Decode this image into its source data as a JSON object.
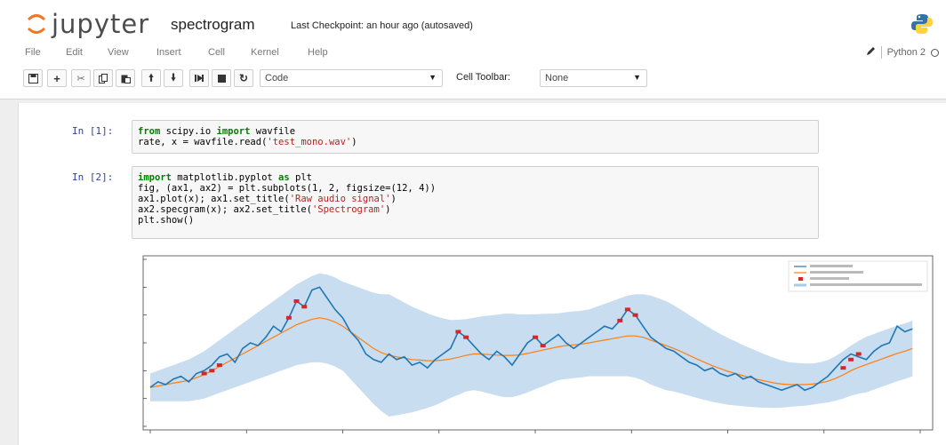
{
  "header": {
    "brand": "jupyter",
    "notebook_name": "spectrogram",
    "checkpoint": "Last Checkpoint: an hour ago (autosaved)"
  },
  "menu": {
    "items": [
      "File",
      "Edit",
      "View",
      "Insert",
      "Cell",
      "Kernel",
      "Help"
    ],
    "kernel_name": "Python 2"
  },
  "toolbar": {
    "cell_type": "Code",
    "cell_toolbar_label": "Cell Toolbar:",
    "cell_toolbar_value": "None",
    "icons": [
      "save-icon",
      "plus-icon",
      "scissors-icon",
      "copy-icon",
      "paste-icon",
      "arrow-up-icon",
      "arrow-down-icon",
      "skip-to-end-icon",
      "stop-icon",
      "restart-icon"
    ]
  },
  "cells": [
    {
      "prompt": "In [1]:",
      "lines": [
        "from scipy.io import wavfile",
        "rate, x = wavfile.read('test_mono.wav')"
      ]
    },
    {
      "prompt": "In [2]:",
      "lines": [
        "import matplotlib.pyplot as plt",
        "fig, (ax1, ax2) = plt.subplots(1, 2, figsize=(12, 4))",
        "ax1.plot(x); ax1.set_title('Raw audio signal')",
        "ax2.specgram(x); ax2.set_title('Spectrogram')",
        "plt.show()"
      ]
    }
  ],
  "colors": {
    "prompt": "#303f9f",
    "keyword": "#008000",
    "string": "#ba2121",
    "series_actual": "#1f77b4",
    "series_average": "#ff7f0e",
    "band": "#aacbe6",
    "anomaly": "#d62728"
  },
  "chart_data": {
    "type": "line",
    "xlim": [
      0,
      100
    ],
    "ylim": [
      0,
      6
    ],
    "legend_position": "top-right",
    "series": [
      {
        "values": [
          1.4,
          1.6,
          1.5,
          1.7,
          1.8,
          1.6,
          1.9,
          2.0,
          2.2,
          2.5,
          2.6,
          2.3,
          2.8,
          3.0,
          2.9,
          3.2,
          3.6,
          3.4,
          3.9,
          4.5,
          4.3,
          4.9,
          5.0,
          4.6,
          4.2,
          3.9,
          3.4,
          3.1,
          2.6,
          2.4,
          2.3,
          2.6,
          2.4,
          2.5,
          2.2,
          2.3,
          2.1,
          2.4,
          2.6,
          2.8,
          3.4,
          3.2,
          2.9,
          2.6,
          2.4,
          2.7,
          2.5,
          2.2,
          2.6,
          3.0,
          3.2,
          2.9,
          3.1,
          3.3,
          3.0,
          2.8,
          3.0,
          3.2,
          3.4,
          3.6,
          3.5,
          3.8,
          4.2,
          4.0,
          3.6,
          3.2,
          3.0,
          2.8,
          2.7,
          2.5,
          2.3,
          2.2,
          2.0,
          2.1,
          1.9,
          1.8,
          1.9,
          1.7,
          1.8,
          1.6,
          1.5,
          1.4,
          1.3,
          1.4,
          1.5,
          1.3,
          1.4,
          1.6,
          1.8,
          2.1,
          2.4,
          2.6,
          2.5,
          2.4,
          2.7,
          2.9,
          3.0,
          3.6,
          3.4,
          3.5
        ]
      },
      {
        "values": [
          1.4,
          1.45,
          1.5,
          1.55,
          1.6,
          1.65,
          1.75,
          1.85,
          2.0,
          2.15,
          2.3,
          2.45,
          2.6,
          2.75,
          2.9,
          3.05,
          3.2,
          3.35,
          3.5,
          3.65,
          3.75,
          3.85,
          3.9,
          3.85,
          3.75,
          3.6,
          3.4,
          3.2,
          3.0,
          2.8,
          2.65,
          2.55,
          2.5,
          2.45,
          2.4,
          2.38,
          2.36,
          2.36,
          2.38,
          2.42,
          2.48,
          2.55,
          2.6,
          2.6,
          2.58,
          2.56,
          2.55,
          2.55,
          2.57,
          2.62,
          2.68,
          2.74,
          2.8,
          2.86,
          2.9,
          2.93,
          2.96,
          3.0,
          3.05,
          3.1,
          3.15,
          3.2,
          3.25,
          3.25,
          3.2,
          3.1,
          3.0,
          2.9,
          2.8,
          2.68,
          2.55,
          2.42,
          2.3,
          2.18,
          2.08,
          1.98,
          1.9,
          1.82,
          1.75,
          1.68,
          1.62,
          1.56,
          1.52,
          1.5,
          1.5,
          1.5,
          1.52,
          1.56,
          1.62,
          1.72,
          1.85,
          2.0,
          2.12,
          2.22,
          2.32,
          2.42,
          2.52,
          2.62,
          2.7,
          2.8
        ]
      }
    ],
    "band_halfwidth": [
      0.5,
      0.55,
      0.6,
      0.65,
      0.7,
      0.75,
      0.8,
      0.85,
      0.9,
      0.95,
      1.0,
      1.05,
      1.1,
      1.15,
      1.2,
      1.25,
      1.3,
      1.35,
      1.4,
      1.45,
      1.5,
      1.55,
      1.6,
      1.6,
      1.6,
      1.6,
      1.7,
      1.8,
      1.9,
      2.0,
      2.1,
      2.2,
      2.1,
      2.0,
      1.9,
      1.8,
      1.7,
      1.6,
      1.5,
      1.4,
      1.35,
      1.3,
      1.3,
      1.35,
      1.4,
      1.45,
      1.5,
      1.5,
      1.45,
      1.4,
      1.35,
      1.3,
      1.25,
      1.2,
      1.2,
      1.2,
      1.2,
      1.2,
      1.25,
      1.3,
      1.35,
      1.4,
      1.45,
      1.5,
      1.55,
      1.6,
      1.6,
      1.6,
      1.55,
      1.5,
      1.45,
      1.4,
      1.35,
      1.3,
      1.25,
      1.2,
      1.15,
      1.1,
      1.05,
      1.0,
      0.95,
      0.9,
      0.85,
      0.8,
      0.78,
      0.76,
      0.74,
      0.74,
      0.76,
      0.8,
      0.85,
      0.9,
      0.95,
      1.0,
      1.0,
      1.0,
      1.0,
      1.0,
      1.0,
      1.0
    ],
    "anomaly_points": [
      {
        "x": 7,
        "y": 1.9
      },
      {
        "x": 8,
        "y": 2.0
      },
      {
        "x": 9,
        "y": 2.2
      },
      {
        "x": 18,
        "y": 3.9
      },
      {
        "x": 19,
        "y": 4.5
      },
      {
        "x": 20,
        "y": 4.3
      },
      {
        "x": 40,
        "y": 3.4
      },
      {
        "x": 41,
        "y": 3.2
      },
      {
        "x": 50,
        "y": 3.2
      },
      {
        "x": 51,
        "y": 2.9
      },
      {
        "x": 61,
        "y": 3.8
      },
      {
        "x": 62,
        "y": 4.2
      },
      {
        "x": 63,
        "y": 4.0
      },
      {
        "x": 90,
        "y": 2.1
      },
      {
        "x": 91,
        "y": 2.4
      },
      {
        "x": 92,
        "y": 2.6
      }
    ]
  }
}
